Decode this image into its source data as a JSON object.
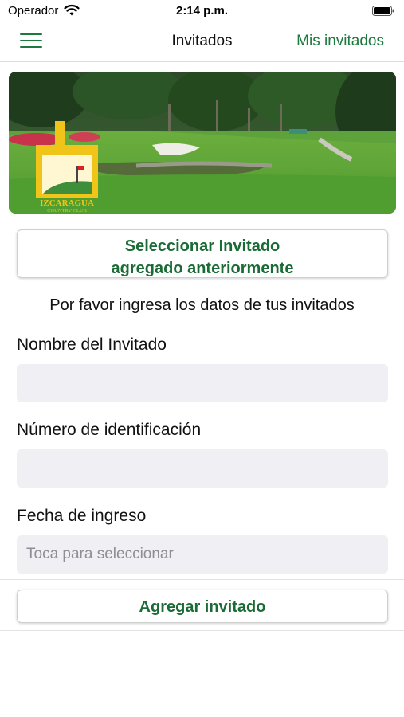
{
  "status_bar": {
    "carrier": "Operador",
    "time": "2:14 p.m."
  },
  "nav": {
    "title": "Invitados",
    "right_action": "Mis invitados",
    "menu_icon": "hamburger-menu-icon"
  },
  "hero": {
    "logo_line1": "IZCARAGUA",
    "logo_line2": "COUNTRY CLUB"
  },
  "select_previous": {
    "line1": "Seleccionar Invitado",
    "line2": "agregado anteriormente"
  },
  "intro_text": "Por favor ingresa los datos de tus invitados",
  "form": {
    "name_label": "Nombre del Invitado",
    "name_value": "",
    "id_label": "Número de identificación",
    "id_value": "",
    "date_label": "Fecha de ingreso",
    "date_placeholder": "Toca para seleccionar"
  },
  "add_button": "Agregar invitado",
  "colors": {
    "accent": "#1d7a3e",
    "field_bg": "#efeff4"
  }
}
